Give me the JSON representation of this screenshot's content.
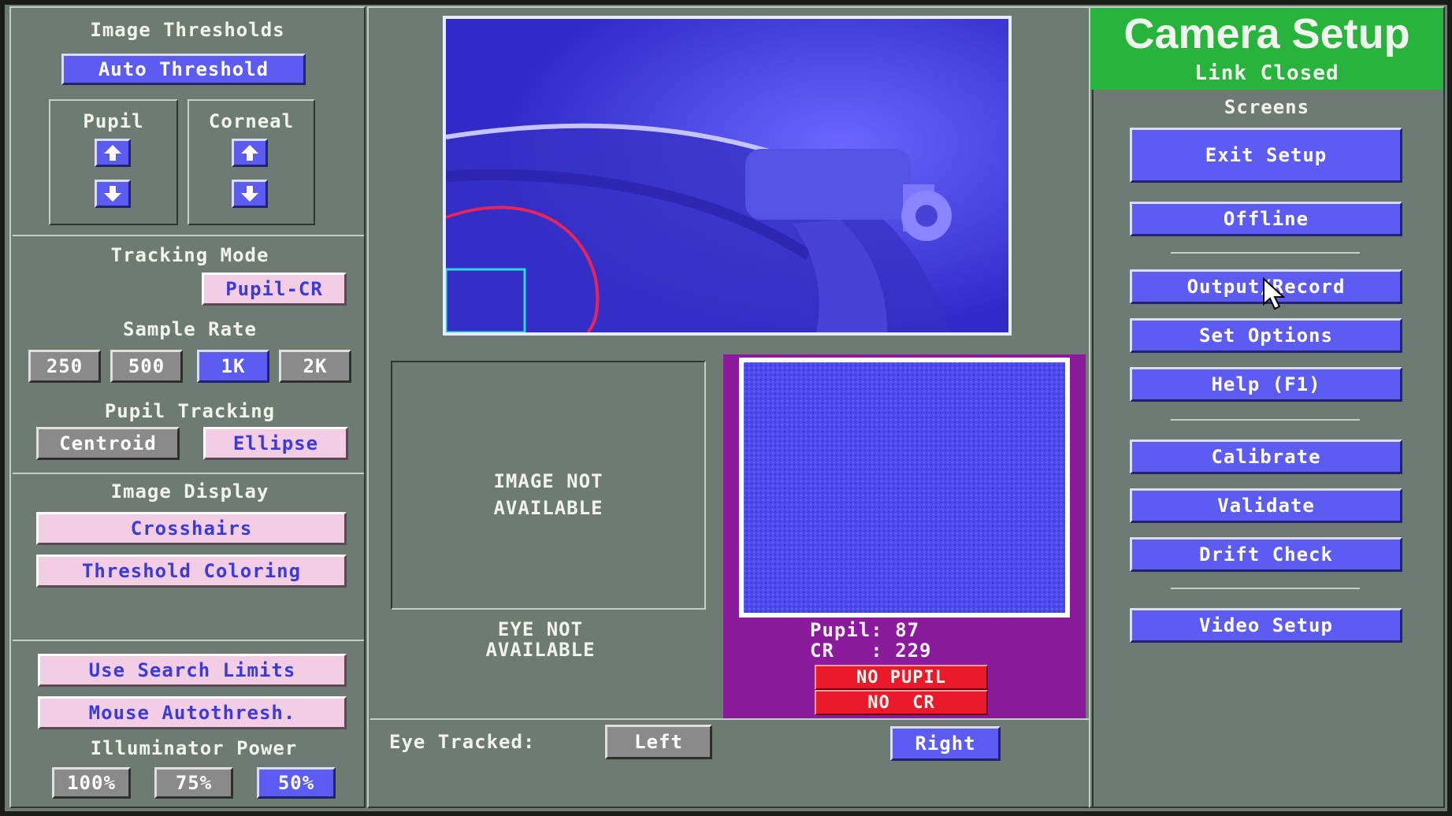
{
  "thresholds": {
    "title": "Image Thresholds",
    "auto_label": "Auto Threshold",
    "pupil_label": "Pupil",
    "corneal_label": "Corneal",
    "up_icon": "arrow-up-icon",
    "down_icon": "arrow-down-icon"
  },
  "tracking_mode": {
    "title": "Tracking Mode",
    "value": "Pupil-CR"
  },
  "sample_rate": {
    "title": "Sample Rate",
    "options": [
      "250",
      "500",
      "1K",
      "2K"
    ],
    "selected": "1K"
  },
  "pupil_tracking": {
    "title": "Pupil Tracking",
    "options": [
      "Centroid",
      "Ellipse"
    ],
    "selected": "Ellipse"
  },
  "image_display": {
    "title": "Image Display",
    "crosshairs": "Crosshairs",
    "threshold_coloring": "Threshold Coloring"
  },
  "search": {
    "use_limits": "Use Search Limits",
    "mouse_autothresh": "Mouse Autothresh."
  },
  "illuminator": {
    "title": "Illuminator Power",
    "options": [
      "100%",
      "75%",
      "50%"
    ],
    "selected": "50%"
  },
  "eye_left": {
    "image_status": "IMAGE NOT\nAVAILABLE",
    "eye_status": "EYE NOT\nAVAILABLE"
  },
  "eye_right": {
    "pupil_readout": "Pupil: 87",
    "cr_readout": "CR   : 229",
    "no_pupil": "NO PUPIL",
    "no_cr": "NO  CR"
  },
  "eye_tracked": {
    "label": "Eye Tracked:",
    "left": "Left",
    "right": "Right",
    "selected": "Right"
  },
  "header": {
    "title": "Camera Setup",
    "link_status": "Link Closed"
  },
  "screens": {
    "title": "Screens",
    "exit_setup": "Exit Setup",
    "offline": "Offline",
    "output_record": "Output/Record",
    "set_options": "Set Options",
    "help": "Help (F1)",
    "calibrate": "Calibrate",
    "validate": "Validate",
    "drift_check": "Drift Check",
    "video_setup": "Video Setup"
  },
  "colors": {
    "screen_bg": "#6e7b72",
    "button_blue": "#5d5cf2",
    "button_pink": "#f2cde4",
    "button_gray": "#8a8a8a",
    "header_green": "#28b43c",
    "eye_panel_magenta": "#8c1a9c",
    "alert_red": "#ea1a2a",
    "camera_blue": "#3e3af2"
  },
  "pointer_icon": "mouse-pointer-icon"
}
